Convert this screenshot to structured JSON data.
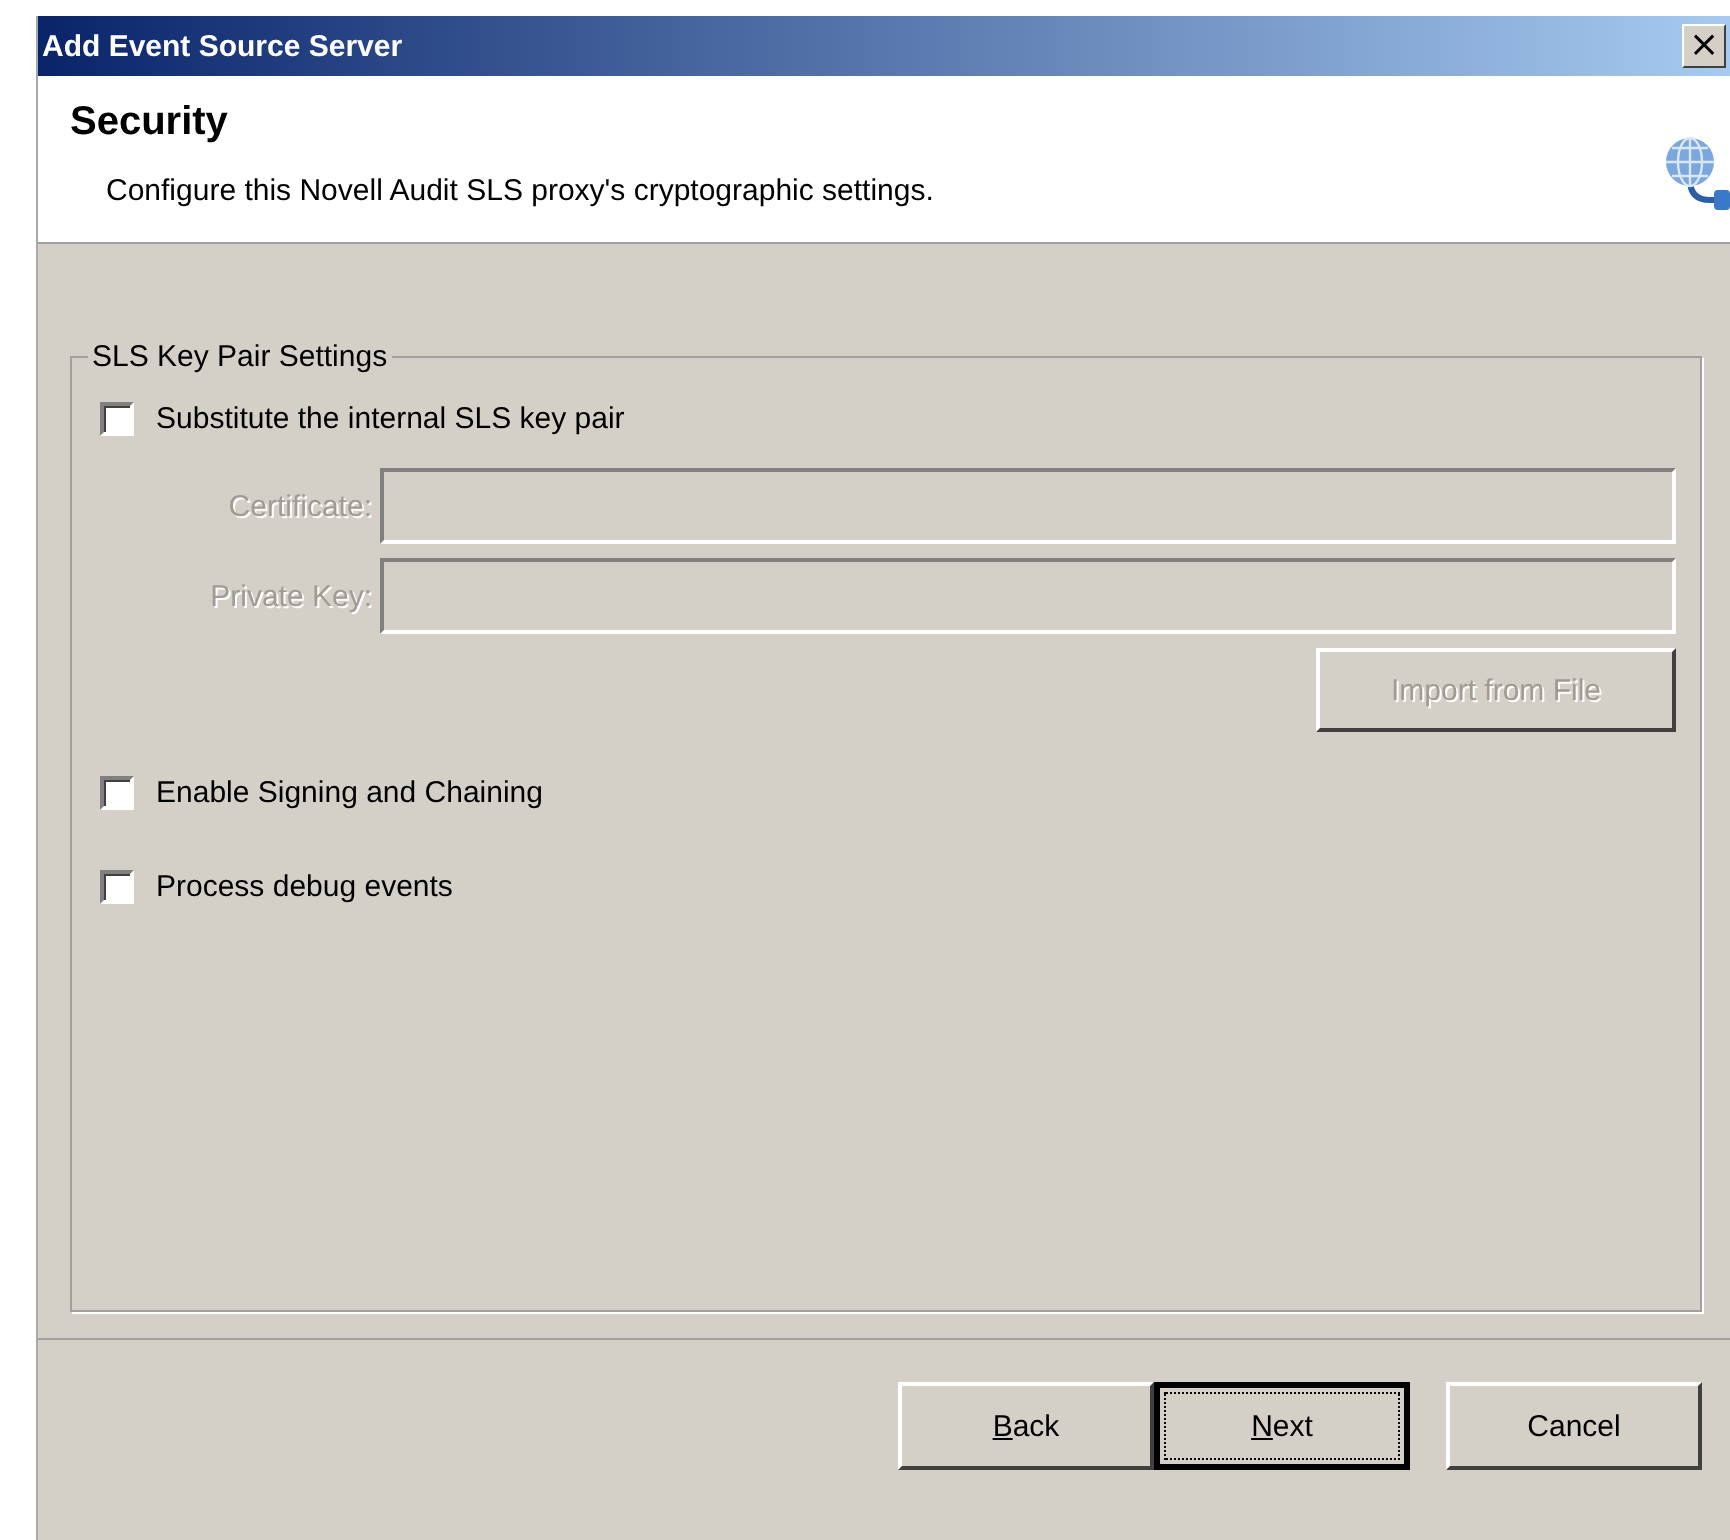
{
  "window": {
    "title": "Add Event Source Server",
    "close": "×"
  },
  "header": {
    "title": "Security",
    "description": "Configure this Novell Audit SLS proxy's cryptographic settings."
  },
  "group": {
    "title": "SLS Key Pair Settings",
    "substitute": {
      "label": "Substitute the internal SLS key pair",
      "checked": false
    },
    "fields": [
      {
        "label": "Certificate:",
        "disabled": true
      },
      {
        "label": "Private Key:",
        "disabled": true
      }
    ],
    "import_button": {
      "label": "Import from File",
      "disabled": true
    },
    "options": [
      {
        "label": "Enable Signing and Chaining",
        "checked": false
      },
      {
        "label": "Process debug events",
        "checked": false
      }
    ]
  },
  "buttons": [
    {
      "label": "Back",
      "mnemonic": true,
      "default": false
    },
    {
      "label": "Next",
      "mnemonic": true,
      "default": true
    },
    {
      "label": "Cancel",
      "mnemonic": false,
      "default": false
    }
  ]
}
